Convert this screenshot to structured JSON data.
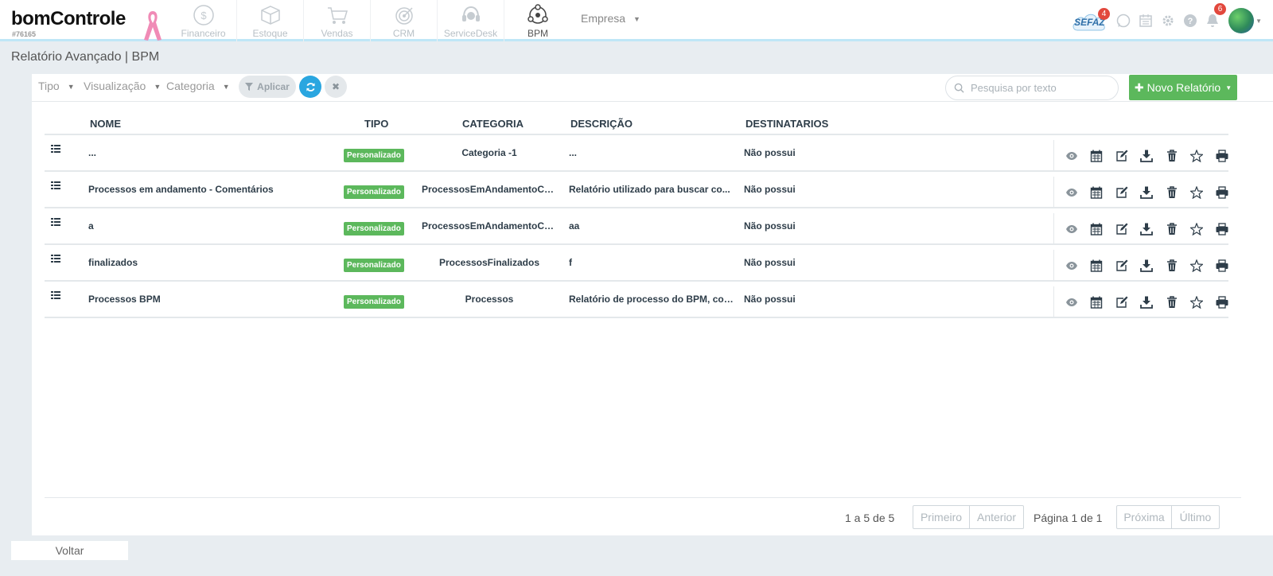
{
  "brand": {
    "logo": "bomControle",
    "account_id": "#76165"
  },
  "nav": {
    "items": [
      {
        "label": "Financeiro",
        "icon": "dollar-coin-icon"
      },
      {
        "label": "Estoque",
        "icon": "box-icon"
      },
      {
        "label": "Vendas",
        "icon": "cart-icon"
      },
      {
        "label": "CRM",
        "icon": "target-icon"
      },
      {
        "label": "ServiceDesk",
        "icon": "headset-icon"
      },
      {
        "label": "BPM",
        "icon": "bpm-cycle-icon",
        "active": true
      }
    ],
    "empresa": "Empresa"
  },
  "header_icons": {
    "sefaz_label": "SEFAZ",
    "sefaz_badge": "4",
    "notifications_badge": "6",
    "icons": [
      "whatsapp-icon",
      "calendar-icon",
      "gear-icon",
      "help-icon",
      "bell-icon",
      "avatar"
    ]
  },
  "page": {
    "title": "Relatório Avançado | BPM"
  },
  "filters": {
    "tipo": "Tipo",
    "visualizacao": "Visualização",
    "categoria": "Categoria",
    "apply": "Aplicar",
    "search_placeholder": "Pesquisa por texto",
    "new_report": "Novo Relatório"
  },
  "table": {
    "headers": {
      "nome": "NOME",
      "tipo": "TIPO",
      "categoria": "CATEGORIA",
      "descricao": "DESCRIÇÃO",
      "destinatarios": "DESTINATARIOS"
    },
    "rows": [
      {
        "nome": "...",
        "tipo": "Personalizado",
        "categoria": "Categoria -1",
        "descricao": "...",
        "destinatarios": "Não possui"
      },
      {
        "nome": "Processos em andamento - Comentários",
        "tipo": "Personalizado",
        "categoria": "ProcessosEmAndamentoCo...",
        "descricao": "Relatório utilizado para buscar co...",
        "destinatarios": "Não possui"
      },
      {
        "nome": "a",
        "tipo": "Personalizado",
        "categoria": "ProcessosEmAndamentoCo...",
        "descricao": "aa",
        "destinatarios": "Não possui"
      },
      {
        "nome": "finalizados",
        "tipo": "Personalizado",
        "categoria": "ProcessosFinalizados",
        "descricao": "f",
        "destinatarios": "Não possui"
      },
      {
        "nome": "Processos BPM",
        "tipo": "Personalizado",
        "categoria": "Processos",
        "descricao": "Relatório de processo do BPM, cont...",
        "destinatarios": "Não possui"
      }
    ],
    "row_actions": [
      "eye-icon",
      "calendar-icon",
      "edit-icon",
      "download-icon",
      "trash-icon",
      "star-icon",
      "print-icon"
    ]
  },
  "pagination": {
    "count": "1 a 5 de 5",
    "first": "Primeiro",
    "prev": "Anterior",
    "page_info": "Página 1 de 1",
    "next": "Próxima",
    "last": "Último"
  },
  "footer": {
    "back": "Voltar"
  },
  "colors": {
    "accent_blue": "#2aa6e0",
    "success_green": "#5cb85c",
    "badge_red": "#e2483d",
    "text_dark": "#2e3d49"
  }
}
